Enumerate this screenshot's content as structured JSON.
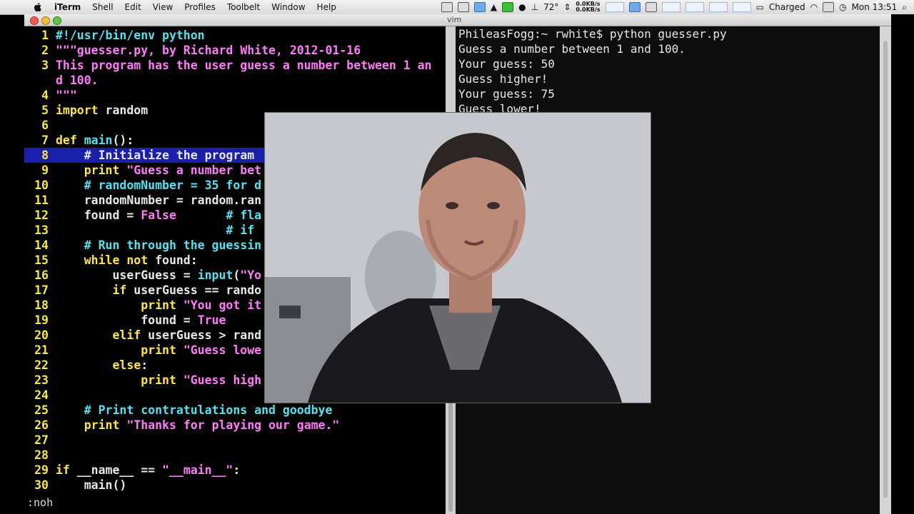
{
  "menubar": {
    "app": "iTerm",
    "items": [
      "Shell",
      "Edit",
      "View",
      "Profiles",
      "Toolbelt",
      "Window",
      "Help"
    ],
    "temperature": "72°",
    "net_up": "0.0KB/s",
    "net_down": "0.0KB/s",
    "battery": "Charged",
    "clock": "Mon 13:51"
  },
  "window": {
    "title": "vim"
  },
  "editor": {
    "lines": [
      {
        "n": "1",
        "segs": [
          {
            "t": "#!/usr/bin/env python",
            "c": "cmt"
          }
        ]
      },
      {
        "n": "2",
        "segs": [
          {
            "t": "\"\"\"guesser.py, by Richard White, 2012-01-16",
            "c": "str"
          }
        ]
      },
      {
        "n": "3",
        "segs": [
          {
            "t": "This program has the user guess a number between 1 an",
            "c": "str"
          }
        ]
      },
      {
        "n": "",
        "segs": [
          {
            "t": "d 100.",
            "c": "str"
          }
        ]
      },
      {
        "n": "4",
        "segs": [
          {
            "t": "\"\"\"",
            "c": "str"
          }
        ]
      },
      {
        "n": "5",
        "segs": [
          {
            "t": "import",
            "c": "kw"
          },
          {
            "t": " random",
            "c": "pl"
          }
        ]
      },
      {
        "n": "6",
        "segs": []
      },
      {
        "n": "7",
        "segs": [
          {
            "t": "def",
            "c": "kw"
          },
          {
            "t": " ",
            "c": "pl"
          },
          {
            "t": "main",
            "c": "cmt"
          },
          {
            "t": "():",
            "c": "pl"
          }
        ]
      },
      {
        "n": "8",
        "hl": true,
        "segs": [
          {
            "t": "    # Initialize the program",
            "c": "pl"
          }
        ]
      },
      {
        "n": "9",
        "segs": [
          {
            "t": "    print ",
            "c": "kw"
          },
          {
            "t": "\"Guess a number bet",
            "c": "str"
          }
        ]
      },
      {
        "n": "10",
        "segs": [
          {
            "t": "    # randomNumber = 35 for d",
            "c": "cmt"
          }
        ]
      },
      {
        "n": "11",
        "segs": [
          {
            "t": "    randomNumber = random.ran",
            "c": "pl"
          }
        ]
      },
      {
        "n": "12",
        "segs": [
          {
            "t": "    found = ",
            "c": "pl"
          },
          {
            "t": "False",
            "c": "const"
          },
          {
            "t": "       ",
            "c": "pl"
          },
          {
            "t": "# fla",
            "c": "cmt"
          }
        ]
      },
      {
        "n": "13",
        "segs": [
          {
            "t": "                        ",
            "c": "pl"
          },
          {
            "t": "# if",
            "c": "cmt"
          }
        ]
      },
      {
        "n": "14",
        "segs": [
          {
            "t": "    # Run through the guessin",
            "c": "cmt"
          }
        ]
      },
      {
        "n": "15",
        "segs": [
          {
            "t": "    while not",
            "c": "kw"
          },
          {
            "t": " found:",
            "c": "pl"
          }
        ]
      },
      {
        "n": "16",
        "segs": [
          {
            "t": "        userGuess = ",
            "c": "pl"
          },
          {
            "t": "input",
            "c": "cmt"
          },
          {
            "t": "(",
            "c": "pl"
          },
          {
            "t": "\"Yo",
            "c": "str"
          }
        ]
      },
      {
        "n": "17",
        "segs": [
          {
            "t": "        if",
            "c": "kw"
          },
          {
            "t": " userGuess == rando",
            "c": "pl"
          }
        ]
      },
      {
        "n": "18",
        "segs": [
          {
            "t": "            print ",
            "c": "kw"
          },
          {
            "t": "\"You got it",
            "c": "str"
          }
        ]
      },
      {
        "n": "19",
        "segs": [
          {
            "t": "            found = ",
            "c": "pl"
          },
          {
            "t": "True",
            "c": "const"
          }
        ]
      },
      {
        "n": "20",
        "segs": [
          {
            "t": "        elif",
            "c": "kw"
          },
          {
            "t": " userGuess > rand",
            "c": "pl"
          }
        ]
      },
      {
        "n": "21",
        "segs": [
          {
            "t": "            print ",
            "c": "kw"
          },
          {
            "t": "\"Guess lowe",
            "c": "str"
          }
        ]
      },
      {
        "n": "22",
        "segs": [
          {
            "t": "        else",
            "c": "kw"
          },
          {
            "t": ":",
            "c": "pl"
          }
        ]
      },
      {
        "n": "23",
        "segs": [
          {
            "t": "            print ",
            "c": "kw"
          },
          {
            "t": "\"Guess high",
            "c": "str"
          }
        ]
      },
      {
        "n": "24",
        "segs": []
      },
      {
        "n": "25",
        "segs": [
          {
            "t": "    # Print contratulations and goodbye",
            "c": "cmt"
          }
        ]
      },
      {
        "n": "26",
        "segs": [
          {
            "t": "    print ",
            "c": "kw"
          },
          {
            "t": "\"Thanks for playing our game.\"",
            "c": "str"
          }
        ]
      },
      {
        "n": "27",
        "segs": []
      },
      {
        "n": "28",
        "segs": []
      },
      {
        "n": "29",
        "segs": [
          {
            "t": "if",
            "c": "kw"
          },
          {
            "t": " __name__ == ",
            "c": "pl"
          },
          {
            "t": "\"__main__\"",
            "c": "str"
          },
          {
            "t": ":",
            "c": "pl"
          }
        ]
      },
      {
        "n": "30",
        "segs": [
          {
            "t": "    main()",
            "c": "pl"
          }
        ]
      }
    ],
    "cmdline": ":noh"
  },
  "terminal": {
    "lines": [
      "PhileasFogg:~ rwhite$ python guesser.py",
      "Guess a number between 1 and 100.",
      "Your guess: 50",
      "Guess higher!",
      "Your guess: 75",
      "Guess lower!"
    ]
  },
  "colors": {
    "keyword": "#ffe64d",
    "comment": "#58e1ee",
    "string": "#ff7ef6",
    "line_number": "#f7e84a",
    "highlight": "#1a1ea8"
  }
}
